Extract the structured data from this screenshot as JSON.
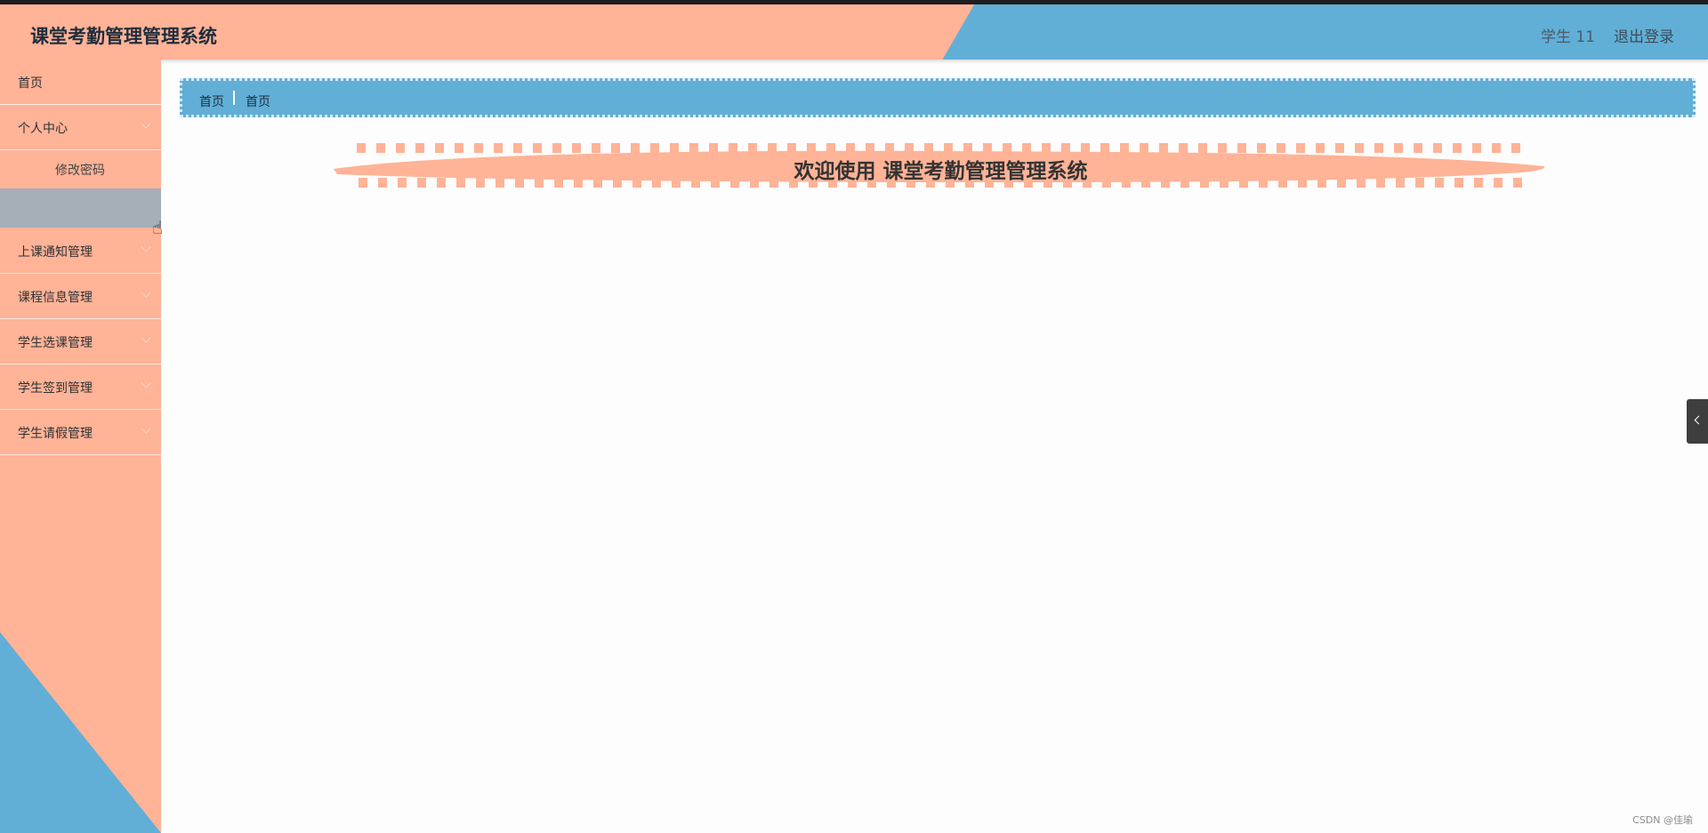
{
  "header": {
    "title": "课堂考勤管理管理系统",
    "user": "学生 11",
    "logout": "退出登录"
  },
  "sidebar": {
    "home": "首页",
    "personal_center": "个人中心",
    "change_password": "修改密码",
    "items": [
      {
        "label": "上课通知管理"
      },
      {
        "label": "课程信息管理"
      },
      {
        "label": "学生选课管理"
      },
      {
        "label": "学生签到管理"
      },
      {
        "label": "学生请假管理"
      }
    ]
  },
  "breadcrumb": {
    "items": [
      "首页",
      "首页"
    ]
  },
  "main": {
    "welcome": "欢迎使用 课堂考勤管理管理系统"
  },
  "watermark": "CSDN @佳瑜",
  "colors": {
    "salmon": "#ffb397",
    "blue": "#61afd6",
    "active_gray": "#a6aeb8"
  }
}
